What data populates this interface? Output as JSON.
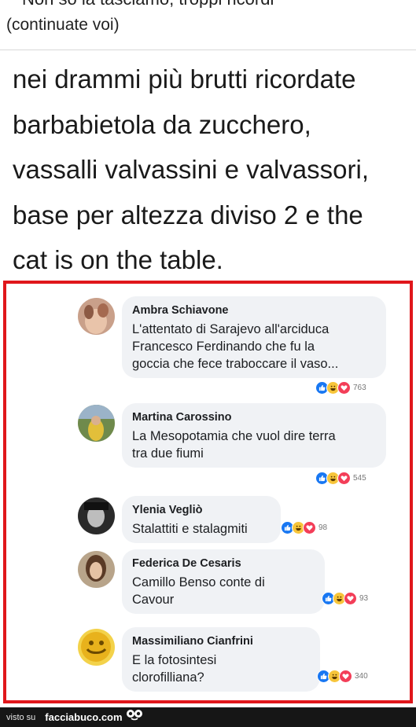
{
  "post": {
    "top_cut_text": "Non so la tasciamo, troppi ricordi",
    "subtitle": "(continuate voi)",
    "lines": [
      "nei drammi più brutti ricordate",
      "barbabietola da zucchero,",
      "vassalli valvassini e valvassori,",
      "base per altezza diviso 2 e the",
      "cat is on the table."
    ]
  },
  "comments": [
    {
      "name": "Ambra Schiavone",
      "lines": [
        "L'attentato di Sarajevo all'arciduca",
        "Francesco Ferdinando che fu la",
        "goccia che fece traboccare il vaso..."
      ],
      "reactions": "763"
    },
    {
      "name": "Martina Carossino",
      "lines": [
        "La Mesopotamia che vuol dire terra",
        "tra due fiumi"
      ],
      "reactions": "545"
    },
    {
      "name": "Ylenia Vegliò",
      "lines": [
        "Stalattiti e stalagmiti"
      ],
      "reactions": "98"
    },
    {
      "name": "Federica De Cesaris",
      "lines": [
        "Camillo Benso conte di",
        "Cavour"
      ],
      "reactions": "93"
    },
    {
      "name": "Massimiliano Cianfrini",
      "lines": [
        "E la fotosintesi",
        "clorofilliana?"
      ],
      "reactions": "340"
    }
  ],
  "footer": {
    "visto_su": "visto su",
    "brand": "facciabuco.com"
  },
  "colors": {
    "frame_border": "#e0161b",
    "bubble_bg": "#f0f2f5",
    "like": "#1877f2",
    "haha": "#f7c53a",
    "love": "#f33e58",
    "footer_bg": "#161616"
  },
  "icons": [
    "like-reaction-icon",
    "haha-reaction-icon",
    "love-reaction-icon",
    "facciabuco-logo-icon"
  ]
}
